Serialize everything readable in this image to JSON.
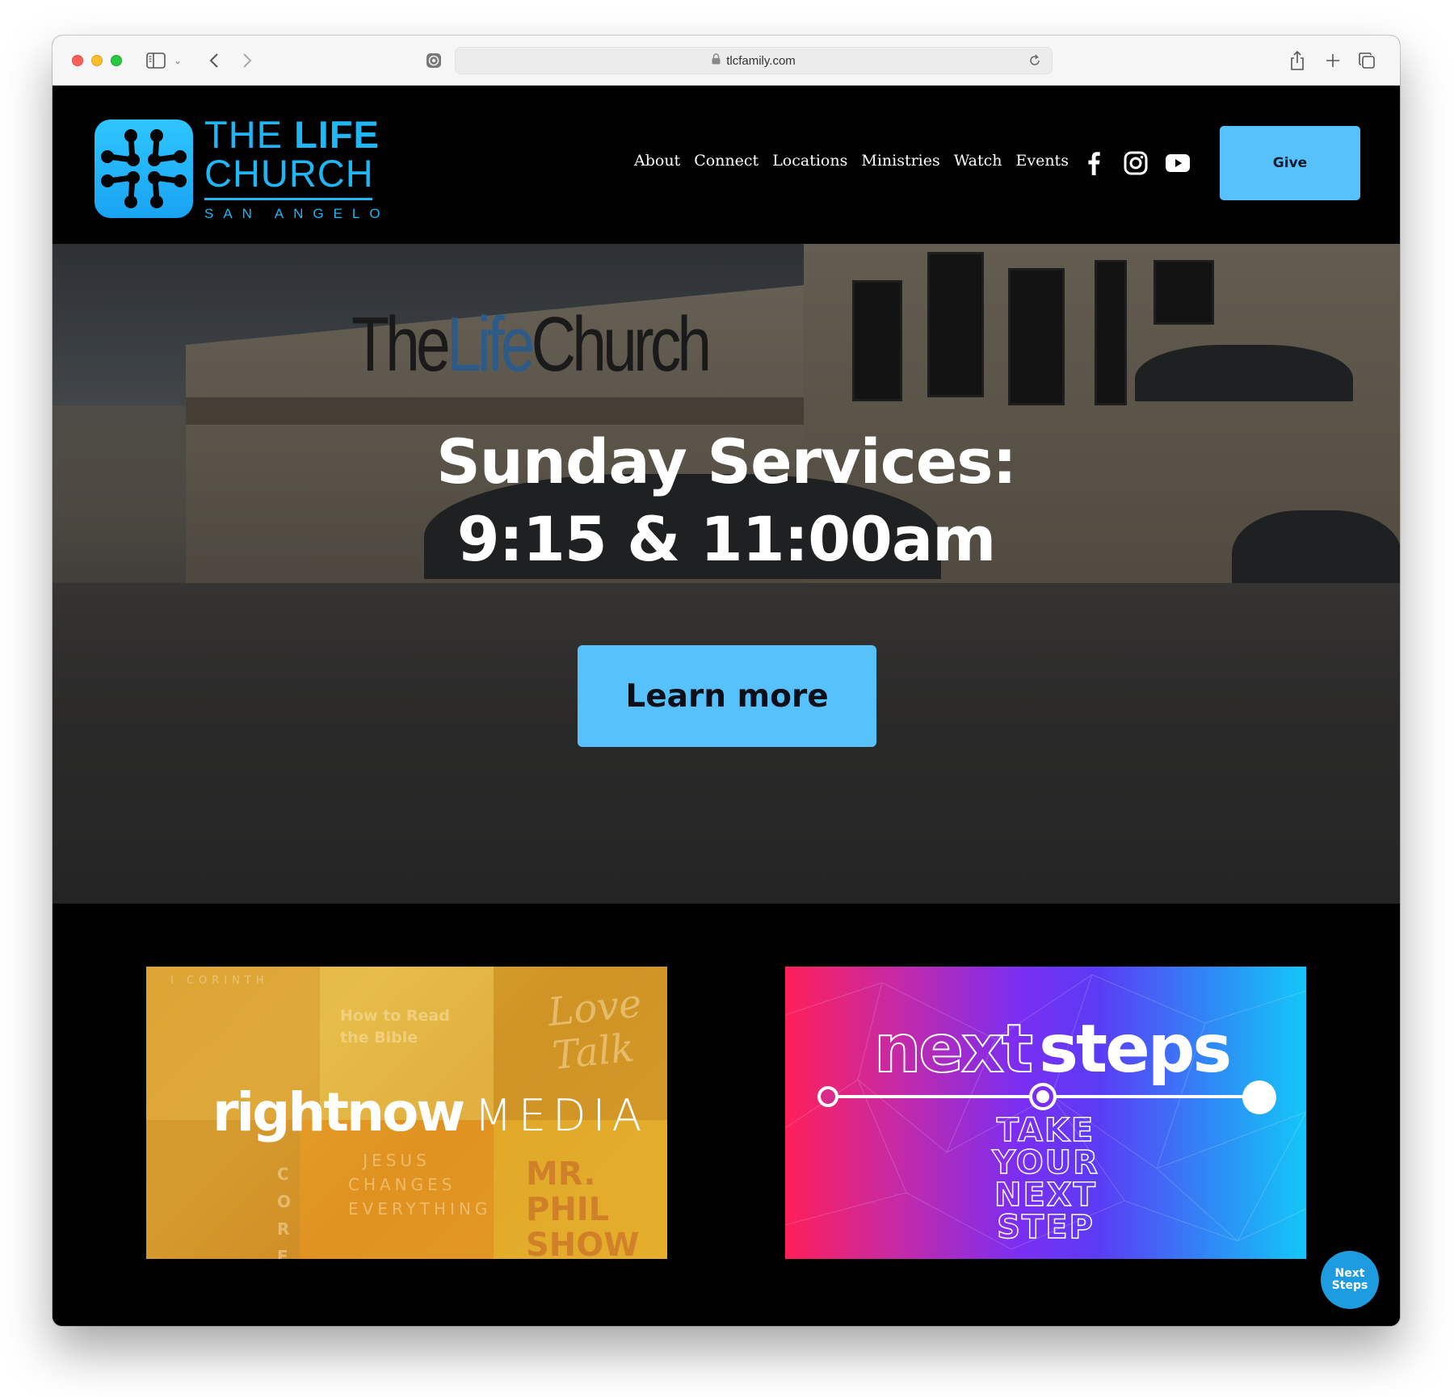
{
  "browser": {
    "url": "tlcfamily.com",
    "icons": {
      "sidebar": "sidebar-icon",
      "sidebar_menu": "chevron-down-icon",
      "back": "chevron-left-icon",
      "forward": "chevron-right-icon",
      "privacy": "privacy-report-icon",
      "lock": "lock-icon",
      "reload": "reload-icon",
      "share": "share-icon",
      "new_tab": "plus-icon",
      "tab_overview": "tabs-icon"
    }
  },
  "header": {
    "logo": {
      "line1_light": "THE ",
      "line1_bold": "LIFE",
      "line2": "CHURCH",
      "line3": "SAN ANGELO"
    },
    "nav": [
      {
        "label": "About"
      },
      {
        "label": "Connect"
      },
      {
        "label": "Locations"
      },
      {
        "label": "Ministries"
      },
      {
        "label": "Watch"
      },
      {
        "label": "Events"
      }
    ],
    "social": [
      "facebook-icon",
      "instagram-icon",
      "youtube-icon"
    ],
    "give_label": "Give"
  },
  "hero": {
    "sign_text_dark1": "The",
    "sign_text_blue": "Life",
    "sign_text_dark2": "Church",
    "title_line1": "Sunday Services:",
    "title_line2": "9:15 & 11:00am",
    "cta_label": "Learn more"
  },
  "cards": {
    "rightnow": {
      "logo_bold": "rightnow",
      "logo_light": "MEDIA",
      "tiles": [
        "I CORINTH",
        "How to Read the Bible",
        "Love Talk",
        "JESUS CHANGES EVERYTHING",
        "MR. PHIL SHOW",
        "CORE"
      ]
    },
    "nextsteps": {
      "title_outline": "next",
      "title_solid": "steps",
      "tagline": [
        "TAKE",
        "YOUR",
        "NEXT",
        "STEP"
      ]
    }
  },
  "floating_button": {
    "line1": "Next",
    "line2": "Steps"
  },
  "colors": {
    "accent": "#56c1fa",
    "logo_blue": "#1fb6f5",
    "bubble": "#1e9ce0"
  }
}
